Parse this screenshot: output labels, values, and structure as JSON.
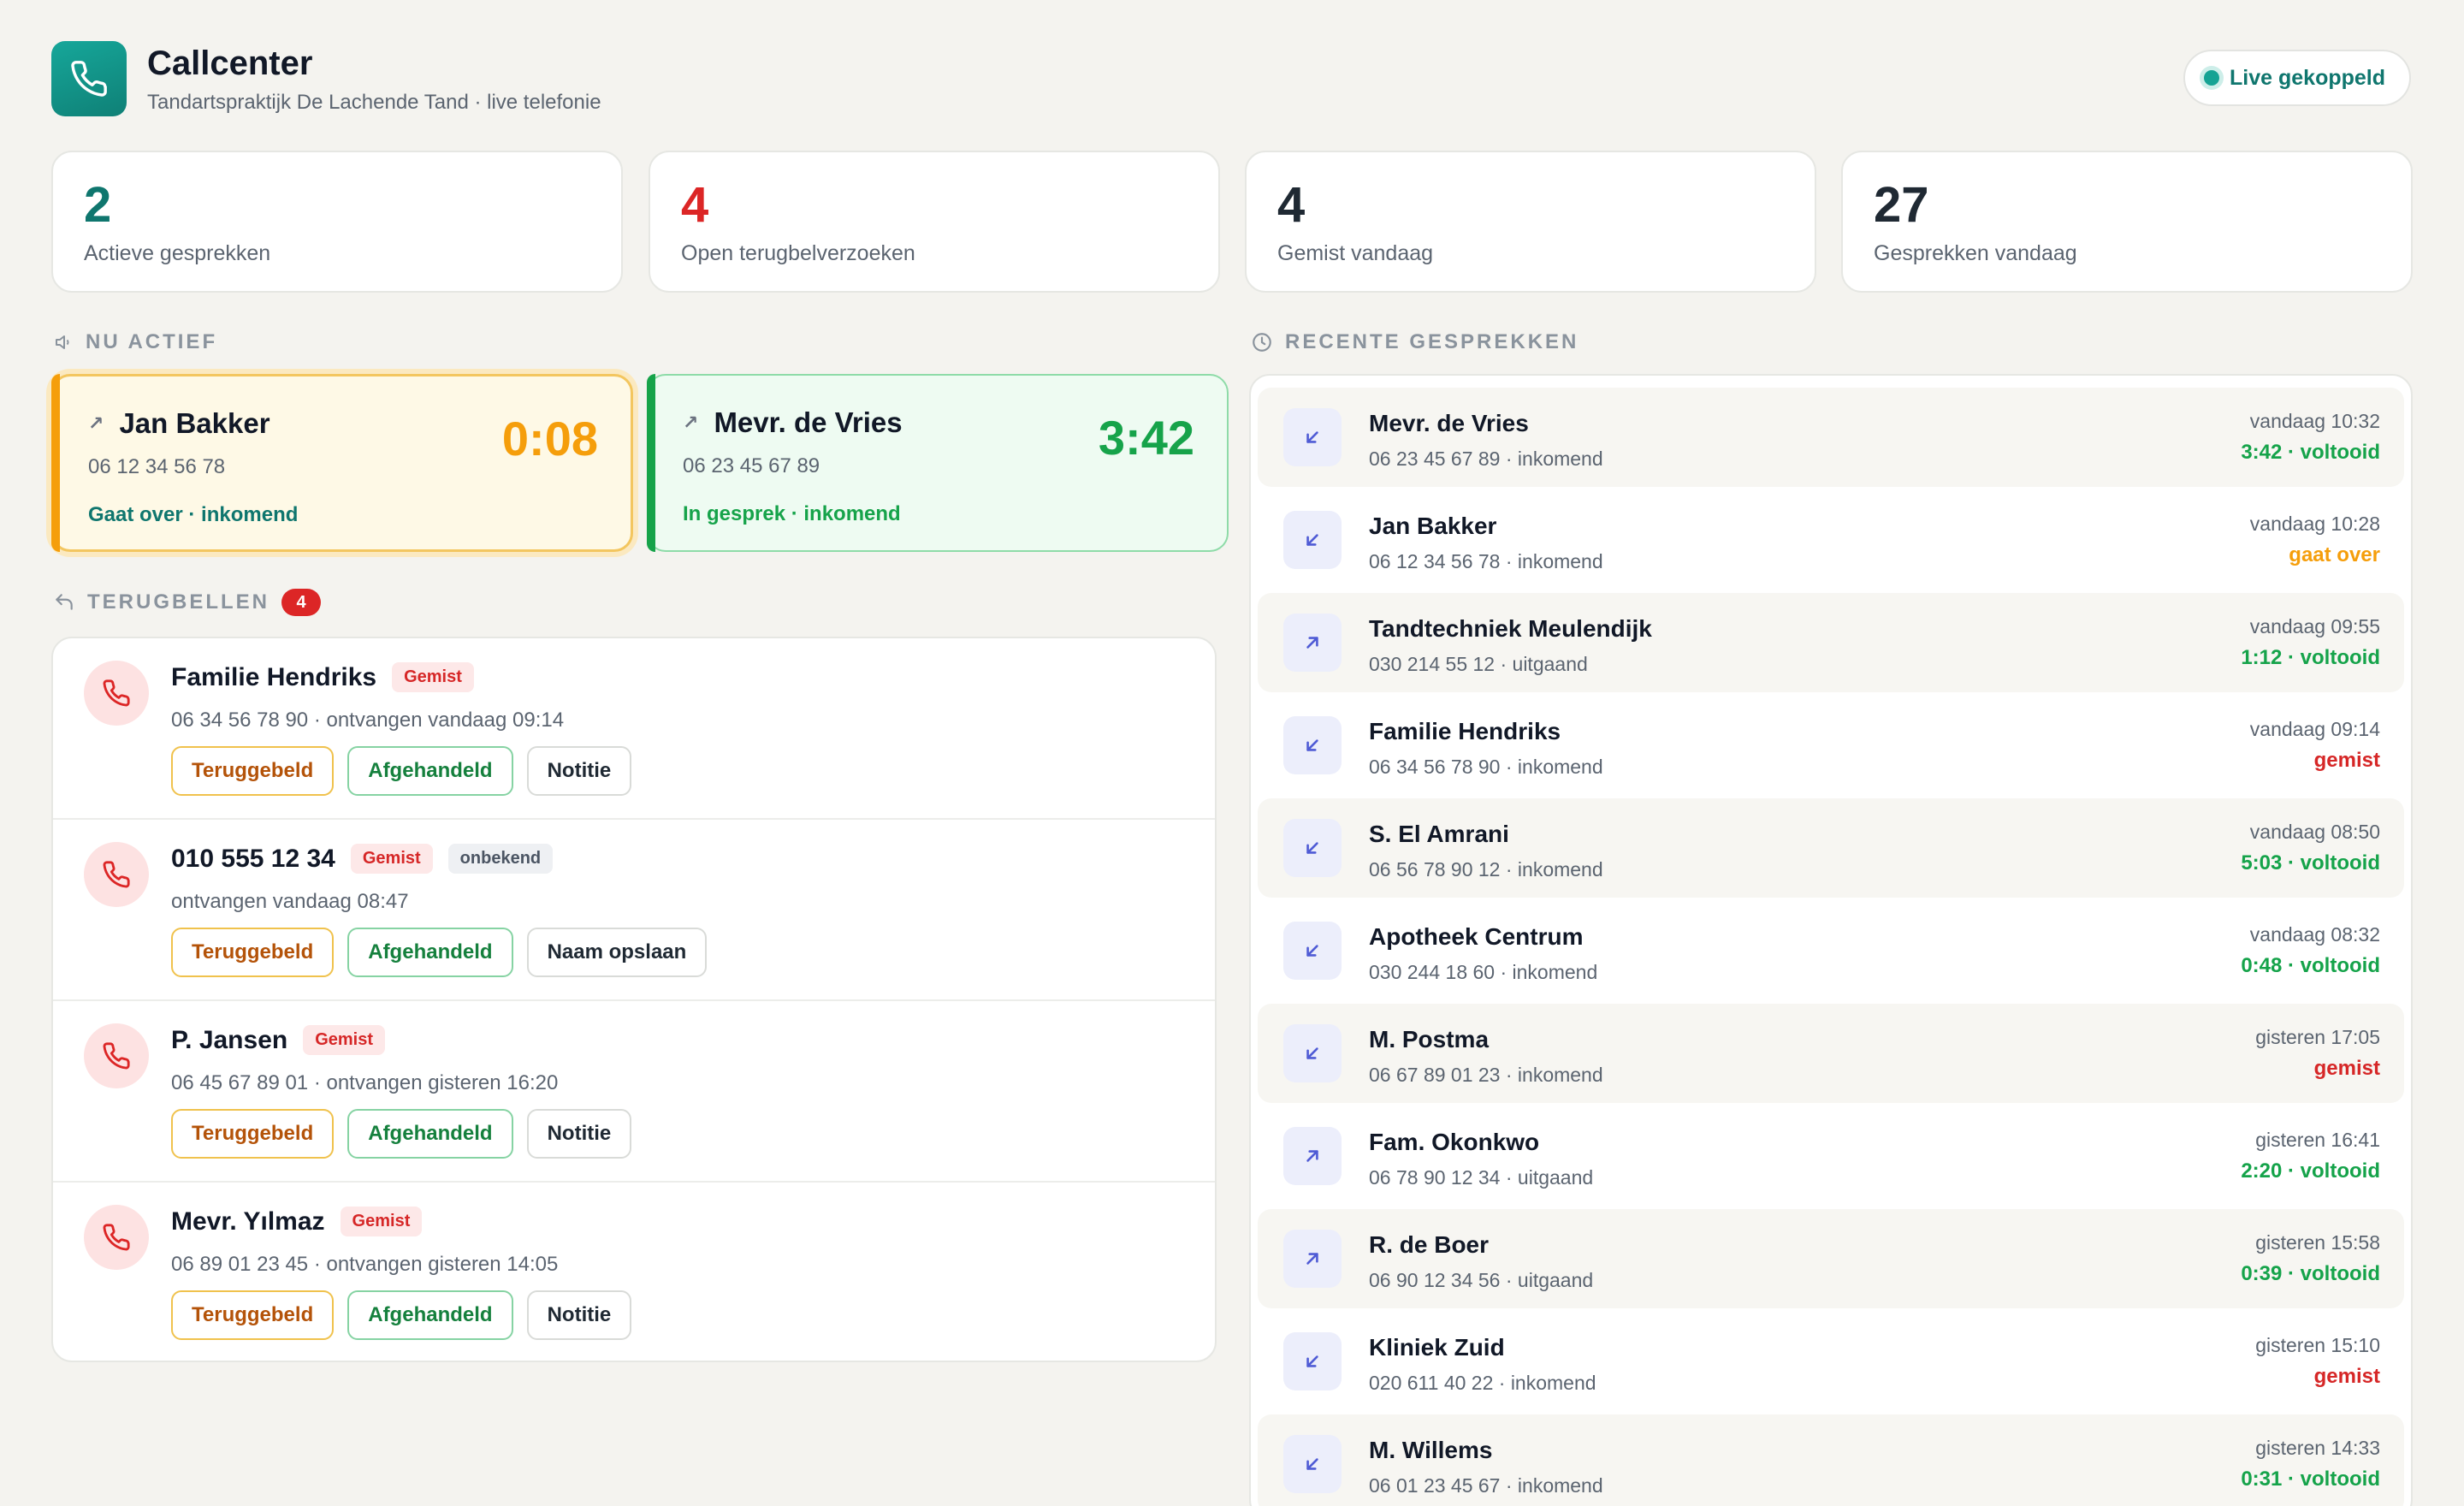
{
  "header": {
    "title": "Callcenter",
    "subtitle": "Tandartspraktijk De Lachende Tand · live telefonie",
    "live_label": "Live gekoppeld"
  },
  "stats": [
    {
      "value": "2",
      "label": "Actieve gesprekken",
      "color": "#0f766e"
    },
    {
      "value": "4",
      "label": "Open terugbelverzoeken",
      "color": "#dc2626"
    },
    {
      "value": "4",
      "label": "Gemist vandaag",
      "color": "#1f2933"
    },
    {
      "value": "27",
      "label": "Gesprekken vandaag",
      "color": "#1f2933"
    }
  ],
  "active": {
    "heading": "NU ACTIEF",
    "calls": [
      {
        "direction": "↗",
        "name": "Jan Bakker",
        "number": "06 12 34 56 78",
        "status": "Gaat over · inkomend",
        "timer": "0:08",
        "timer_color": "#f59e0b",
        "status_color": "#0f766e"
      },
      {
        "direction": "↗",
        "name": "Mevr. de Vries",
        "number": "06 23 45 67 89",
        "status": "In gesprek · inkomend",
        "timer": "3:42",
        "timer_color": "#16a34a",
        "status_color": "#16a34a"
      }
    ]
  },
  "callbacks": {
    "heading": "TERUGBELLEN",
    "count": "4",
    "items": [
      {
        "name": "Familie Hendriks",
        "tag": "Gemist",
        "extra_tag": "",
        "meta": "06 34 56 78 90 · ontvangen vandaag 09:14",
        "actions": [
          "Teruggebeld",
          "Afgehandeld",
          "Notitie"
        ]
      },
      {
        "name": "010 555 12 34",
        "tag": "Gemist",
        "extra_tag": "onbekend",
        "meta": "ontvangen vandaag 08:47",
        "actions": [
          "Teruggebeld",
          "Afgehandeld",
          "Naam opslaan"
        ]
      },
      {
        "name": "P. Jansen",
        "tag": "Gemist",
        "extra_tag": "",
        "meta": "06 45 67 89 01 · ontvangen gisteren 16:20",
        "actions": [
          "Teruggebeld",
          "Afgehandeld",
          "Notitie"
        ]
      },
      {
        "name": "Mevr. Yılmaz",
        "tag": "Gemist",
        "extra_tag": "",
        "meta": "06 89 01 23 45 · ontvangen gisteren 14:05",
        "actions": [
          "Teruggebeld",
          "Afgehandeld",
          "Notitie"
        ]
      }
    ]
  },
  "recent": {
    "heading": "RECENTE GESPREKKEN",
    "items": [
      {
        "dir": "in",
        "name": "Mevr. de Vries",
        "meta": "06 23 45 67 89 · inkomend",
        "time": "vandaag 10:32",
        "status": "3:42 · voltooid",
        "kind": "done"
      },
      {
        "dir": "in",
        "name": "Jan Bakker",
        "meta": "06 12 34 56 78 · inkomend",
        "time": "vandaag 10:28",
        "status": "gaat over",
        "kind": "ringing"
      },
      {
        "dir": "out",
        "name": "Tandtechniek Meulendijk",
        "meta": "030 214 55 12 · uitgaand",
        "time": "vandaag 09:55",
        "status": "1:12 · voltooid",
        "kind": "done"
      },
      {
        "dir": "in",
        "name": "Familie Hendriks",
        "meta": "06 34 56 78 90 · inkomend",
        "time": "vandaag 09:14",
        "status": "gemist",
        "kind": "missed"
      },
      {
        "dir": "in",
        "name": "S. El Amrani",
        "meta": "06 56 78 90 12 · inkomend",
        "time": "vandaag 08:50",
        "status": "5:03 · voltooid",
        "kind": "done"
      },
      {
        "dir": "in",
        "name": "Apotheek Centrum",
        "meta": "030 244 18 60 · inkomend",
        "time": "vandaag 08:32",
        "status": "0:48 · voltooid",
        "kind": "done"
      },
      {
        "dir": "in",
        "name": "M. Postma",
        "meta": "06 67 89 01 23 · inkomend",
        "time": "gisteren 17:05",
        "status": "gemist",
        "kind": "missed"
      },
      {
        "dir": "out",
        "name": "Fam. Okonkwo",
        "meta": "06 78 90 12 34 · uitgaand",
        "time": "gisteren 16:41",
        "status": "2:20 · voltooid",
        "kind": "done"
      },
      {
        "dir": "out",
        "name": "R. de Boer",
        "meta": "06 90 12 34 56 · uitgaand",
        "time": "gisteren 15:58",
        "status": "0:39 · voltooid",
        "kind": "done"
      },
      {
        "dir": "in",
        "name": "Kliniek Zuid",
        "meta": "020 611 40 22 · inkomend",
        "time": "gisteren 15:10",
        "status": "gemist",
        "kind": "missed"
      },
      {
        "dir": "in",
        "name": "M. Willems",
        "meta": "06 01 23 45 67 · inkomend",
        "time": "gisteren 14:33",
        "status": "0:31 · voltooid",
        "kind": "done"
      }
    ]
  }
}
